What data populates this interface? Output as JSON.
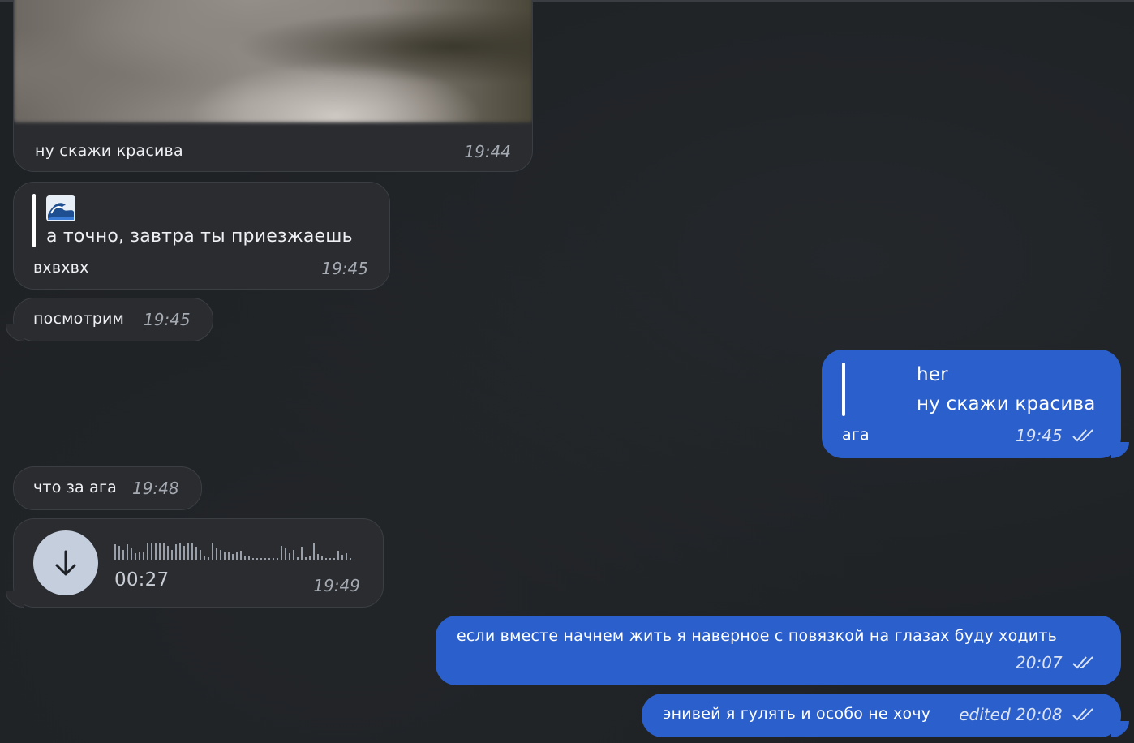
{
  "messages": [
    {
      "id": "m1",
      "side": "in",
      "type": "photo",
      "text": "ну скажи красива",
      "time": "19:44"
    },
    {
      "id": "m2",
      "side": "in",
      "type": "reply",
      "reply_author_icon": "wave-emoji",
      "reply_text": "а точно, завтра ты приезжаешь",
      "text": "вхвхвх",
      "time": "19:45"
    },
    {
      "id": "m3",
      "side": "in",
      "type": "text",
      "text": "посмотрим",
      "time": "19:45"
    },
    {
      "id": "m4",
      "side": "out",
      "type": "reply",
      "reply_author": "her",
      "reply_text": "ну скажи красива",
      "text": "ага",
      "time": "19:45",
      "status": "read"
    },
    {
      "id": "m5",
      "side": "in",
      "type": "text",
      "text": "что за ага",
      "time": "19:48"
    },
    {
      "id": "m6",
      "side": "in",
      "type": "voice",
      "duration": "00:27",
      "time": "19:49",
      "icon": "download-arrow-icon"
    },
    {
      "id": "m7",
      "side": "out",
      "type": "text",
      "text": "если вместе начнем жить я наверное с повязкой на глазах буду ходить",
      "time": "20:07",
      "status": "read"
    },
    {
      "id": "m8",
      "side": "out",
      "type": "text",
      "text": "энивей я гулять и особо не хочу",
      "edited_label": "edited",
      "time": "20:08",
      "status": "read"
    }
  ],
  "colors": {
    "background": "#1f2225",
    "incoming_bubble": "#2a2c30",
    "outgoing_bubble": "#2b5fcb",
    "voice_button": "#c4cedd"
  }
}
